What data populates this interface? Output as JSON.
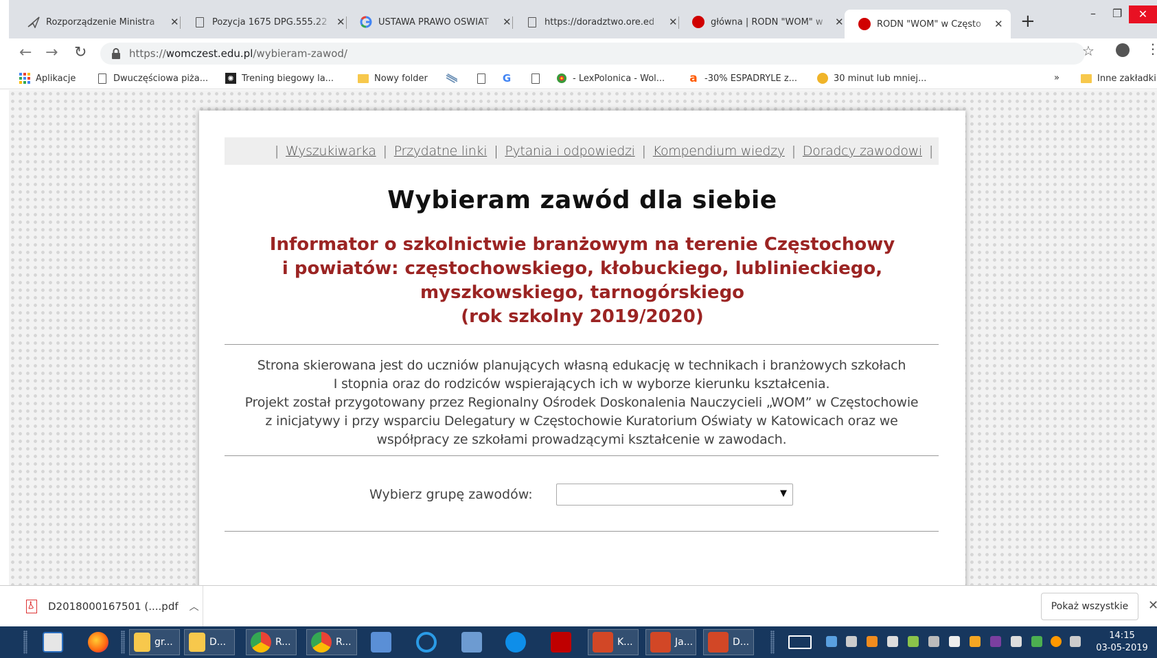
{
  "browser": {
    "tabs": [
      {
        "title": "Rozporządzenie Ministra",
        "icon": "send-icon",
        "active": false
      },
      {
        "title": "Pozycja 1675 DPG.555.22",
        "icon": "page-icon",
        "active": false
      },
      {
        "title": "USTAWA PRAWO OSWIAT",
        "icon": "google-icon",
        "active": false
      },
      {
        "title": "https://doradztwo.ore.ed",
        "icon": "page-icon",
        "active": false
      },
      {
        "title": "główna | RODN \"WOM\" w",
        "icon": "red-dot-icon",
        "active": false
      },
      {
        "title": "RODN \"WOM\" w Często",
        "icon": "red-dot-icon",
        "active": true
      }
    ],
    "new_tab_label": "+",
    "window_controls": {
      "minimize": "–",
      "restore": "❐",
      "close": "✕"
    },
    "url_host": "womczest.edu.pl",
    "url_scheme": "https://",
    "url_path": "/wybieram-zawod/",
    "bookmarks": [
      {
        "label": "Aplikacje",
        "icon": "apps-grid-icon"
      },
      {
        "label": "Dwuczęściowa piża...",
        "icon": "page-icon"
      },
      {
        "label": "Trening biegowy la...",
        "icon": "runner-icon"
      },
      {
        "label": "Nowy folder",
        "icon": "folder-icon"
      },
      {
        "label": "",
        "icon": "striped-icon"
      },
      {
        "label": "",
        "icon": "page-icon"
      },
      {
        "label": "",
        "icon": "google-icon"
      },
      {
        "label": "",
        "icon": "page-icon"
      },
      {
        "label": "- LexPolonica - Wol...",
        "icon": "lexpolonica-icon"
      },
      {
        "label": "-30% ESPADRYLE z...",
        "icon": "allegro-a-icon"
      },
      {
        "label": "30 minut lub mniej...",
        "icon": "cookie-icon"
      }
    ],
    "bookmarks_overflow": "»",
    "other_bookmarks": "Inne zakładki"
  },
  "site": {
    "nav": [
      "Wyszukiwarka",
      "Przydatne linki",
      "Pytania i odpowiedzi",
      "Kompendium wiedzy",
      "Doradcy zawodowi"
    ],
    "nav_separator": "|",
    "title": "Wybieram zawód dla siebie",
    "subtitle_lines": [
      "Informator o szkolnictwie branżowym na terenie Częstochowy",
      "i powiatów: częstochowskiego, kłobuckiego, lublinieckiego,",
      "myszkowskiego, tarnogórskiego",
      "(rok szkolny 2019/2020)"
    ],
    "description_lines": [
      "Strona skierowana jest do uczniów planujących własną edukację w technikach i branżowych szkołach",
      "I stopnia oraz do rodziców wspierających ich w wyborze kierunku kształcenia.",
      "Projekt został przygotowany przez Regionalny Ośrodek Doskonalenia Nauczycieli „WOM” w Częstochowie",
      "z inicjatywy i przy wsparciu Delegatury w Częstochowie Kuratorium Oświaty w Katowicach oraz we",
      "współpracy ze szkołami prowadzącymi kształcenie w zawodach."
    ],
    "select_label": "Wybierz grupę zawodów:",
    "select_value": ""
  },
  "downloads": {
    "file_name": "D2018000167501 (....pdf",
    "show_all_label": "Pokaż wszystkie"
  },
  "taskbar": {
    "buttons": [
      {
        "label": "gr...",
        "icon": "folder-icon"
      },
      {
        "label": "D...",
        "icon": "folder-icon"
      },
      {
        "label": "R...",
        "icon": "chrome-icon"
      },
      {
        "label": "R...",
        "icon": "chrome-icon"
      },
      {
        "label": "K...",
        "icon": "powerpoint-icon"
      },
      {
        "label": "Ja...",
        "icon": "powerpoint-icon"
      },
      {
        "label": "D...",
        "icon": "powerpoint-icon"
      }
    ],
    "clock_time": "14:15",
    "clock_date": "03-05-2019"
  }
}
